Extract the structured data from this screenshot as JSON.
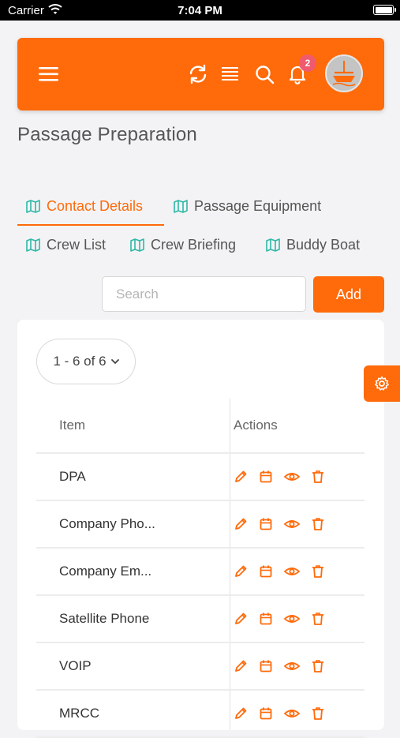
{
  "status_bar": {
    "carrier": "Carrier",
    "time": "7:04 PM"
  },
  "header": {
    "notification_count": "2",
    "icons": [
      "menu-icon",
      "refresh-icon",
      "list-icon",
      "search-icon",
      "bell-icon",
      "avatar"
    ]
  },
  "page": {
    "title": "Passage Preparation"
  },
  "tabs": [
    {
      "label": "Contact Details",
      "active": true
    },
    {
      "label": "Passage Equipment",
      "active": false
    },
    {
      "label": "Crew List",
      "active": false
    },
    {
      "label": "Crew Briefing",
      "active": false
    },
    {
      "label": "Buddy Boat",
      "active": false
    }
  ],
  "search": {
    "placeholder": "Search",
    "value": ""
  },
  "add_button": {
    "label": "Add"
  },
  "pagination": {
    "label": "1 - 6 of 6"
  },
  "table": {
    "columns": [
      "Item",
      "Actions"
    ],
    "rows": [
      {
        "item": "DPA"
      },
      {
        "item": "Company Pho..."
      },
      {
        "item": "Company Em..."
      },
      {
        "item": "Satellite Phone"
      },
      {
        "item": "VOIP"
      },
      {
        "item": "MRCC"
      }
    ],
    "row_actions": [
      "edit-icon",
      "calendar-icon",
      "view-icon",
      "delete-icon"
    ]
  },
  "colors": {
    "accent": "#ff6a0a",
    "tab_icon": "#2fb8a6",
    "badge": "#ef5a6d"
  }
}
